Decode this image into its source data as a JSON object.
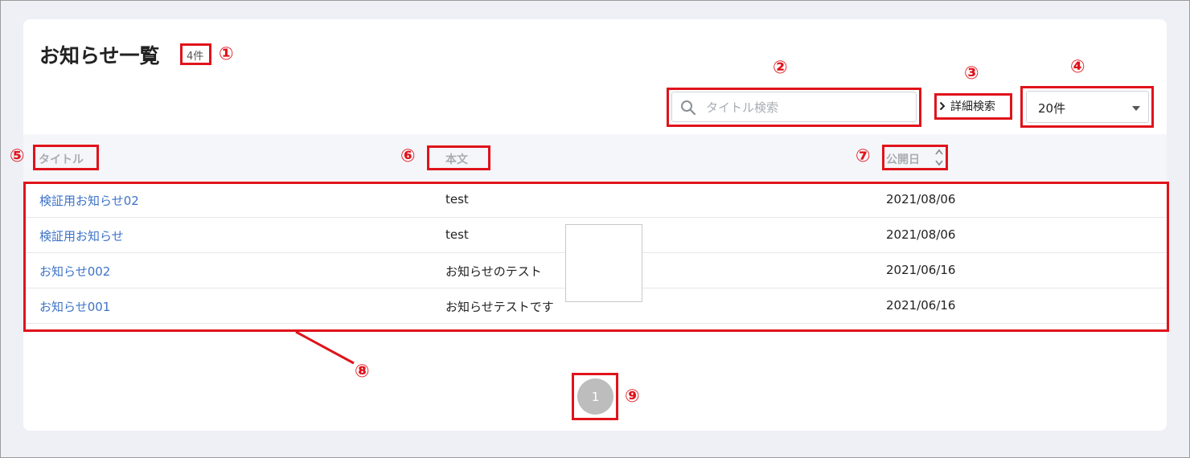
{
  "header": {
    "title": "お知らせ一覧",
    "count": "4件"
  },
  "search": {
    "placeholder": "タイトル検索"
  },
  "advanced_search": {
    "label": "詳細検索"
  },
  "per_page": {
    "selected": "20件"
  },
  "table": {
    "columns": [
      "タイトル",
      "本文",
      "公開日"
    ],
    "rows": [
      {
        "title": "検証用お知らせ02",
        "body": "test",
        "date": "2021/08/06"
      },
      {
        "title": "検証用お知らせ",
        "body": "test",
        "date": "2021/08/06"
      },
      {
        "title": "お知らせ002",
        "body": "お知らせのテスト",
        "date": "2021/06/16"
      },
      {
        "title": "お知らせ001",
        "body": "お知らせテストです",
        "date": "2021/06/16"
      }
    ]
  },
  "pagination": {
    "current": "1"
  },
  "annotations": {
    "markers": [
      "①",
      "②",
      "③",
      "④",
      "⑤",
      "⑥",
      "⑦",
      "⑧",
      "⑨"
    ],
    "color": "#e0131b"
  },
  "colors": {
    "link": "#3e73c8",
    "header_text": "#a9adb3",
    "pagination_active": "#bdbdbd"
  }
}
